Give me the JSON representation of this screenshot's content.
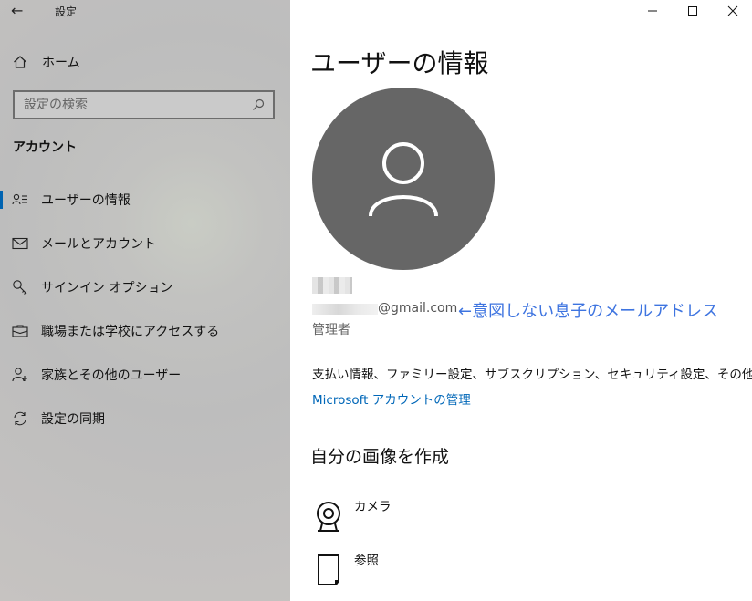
{
  "window": {
    "title": "設定",
    "back_glyph": "←",
    "controls": {
      "minimize": "—",
      "maximize": "☐",
      "close": "✕"
    }
  },
  "sidebar": {
    "home_label": "ホーム",
    "search_placeholder": "設定の検索",
    "section_header": "アカウント",
    "items": [
      {
        "label": "ユーザーの情報",
        "icon": "user-card-icon",
        "active": true
      },
      {
        "label": "メールとアカウント",
        "icon": "mail-icon",
        "active": false
      },
      {
        "label": "サインイン オプション",
        "icon": "key-icon",
        "active": false
      },
      {
        "label": "職場または学校にアクセスする",
        "icon": "briefcase-icon",
        "active": false
      },
      {
        "label": "家族とその他のユーザー",
        "icon": "add-user-icon",
        "active": false
      },
      {
        "label": "設定の同期",
        "icon": "sync-icon",
        "active": false
      }
    ]
  },
  "main": {
    "title": "ユーザーの情報",
    "account": {
      "email_visible": "@gmail.com",
      "role": "管理者"
    },
    "annotation": "←意図しない息子のメールアドレス",
    "billing_text": "支払い情報、ファミリー設定、サブスクリプション、セキュリティ設定、その他",
    "ms_link": "Microsoft アカウントの管理",
    "create_header": "自分の画像を作成",
    "options": [
      {
        "label": "カメラ",
        "icon": "camera-icon"
      },
      {
        "label": "参照",
        "icon": "browse-file-icon"
      }
    ]
  },
  "colors": {
    "accent": "#0067b8",
    "annotation": "#3e74e0",
    "avatar_bg": "#666666"
  }
}
